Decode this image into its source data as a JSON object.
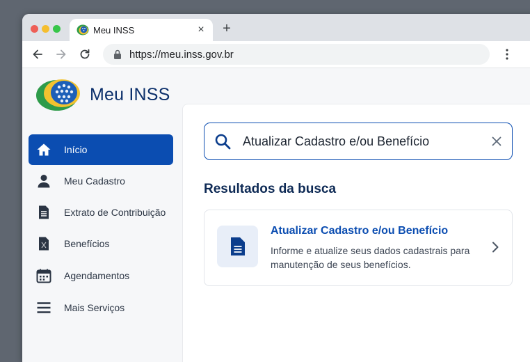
{
  "browser": {
    "tab_title": "Meu INSS",
    "tab_close": "×",
    "new_tab": "+",
    "url": "https://meu.inss.gov.br"
  },
  "brand": {
    "name": "Meu INSS"
  },
  "sidebar": {
    "items": [
      {
        "label": "Início",
        "icon": "home-icon",
        "active": true
      },
      {
        "label": "Meu Cadastro",
        "icon": "person-icon",
        "active": false
      },
      {
        "label": "Extrato de Contribuição",
        "icon": "document-icon",
        "active": false
      },
      {
        "label": "Benefícios",
        "icon": "benefit-document-icon",
        "active": false
      },
      {
        "label": "Agendamentos",
        "icon": "calendar-icon",
        "active": false
      },
      {
        "label": "Mais Serviços",
        "icon": "menu-icon",
        "active": false
      }
    ]
  },
  "search": {
    "value": "Atualizar Cadastro e/ou Benefício"
  },
  "results": {
    "heading": "Resultados da busca",
    "items": [
      {
        "title": "Atualizar Cadastro e/ou Benefício",
        "description": "Informe e atualize seus dados cadastrais para manutenção de seus benefícios."
      }
    ]
  },
  "colors": {
    "primary": "#0b4db1",
    "brand_text": "#0b2f6b",
    "heading": "#0e2a55"
  }
}
